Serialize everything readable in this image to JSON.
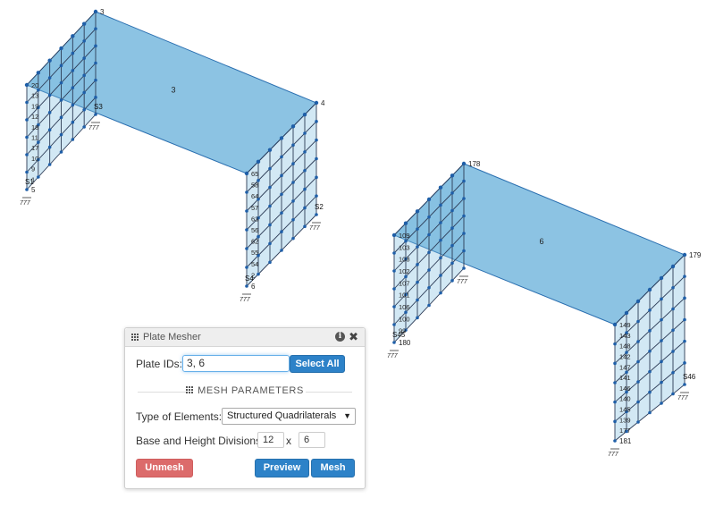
{
  "viewport": {
    "plate_colors": {
      "fill": "#7fbde0",
      "edge": "#2a6fb0",
      "mesh": "#2b3a55",
      "node": "#1f5fa8"
    },
    "left_frame": {
      "plate_label": "3",
      "corner_labels": [
        "3",
        "4",
        "5",
        "6"
      ],
      "node_labels_a": [
        "20",
        "13",
        "19",
        "12",
        "18",
        "11",
        "17",
        "10",
        "9",
        "1"
      ],
      "node_labels_b": [
        "65",
        "58",
        "64",
        "57",
        "63",
        "56",
        "62",
        "55",
        "54",
        "2"
      ],
      "member_labels": [
        "S1",
        "S2",
        "S3",
        "S4"
      ],
      "support_symbol": "777"
    },
    "right_frame": {
      "plate_label": "6",
      "corner_labels": [
        "178",
        "179",
        "180",
        "181"
      ],
      "node_labels_a": [
        "109",
        "103",
        "108",
        "102",
        "107",
        "101",
        "106",
        "100",
        "99"
      ],
      "node_labels_b": [
        "149",
        "143",
        "148",
        "142",
        "147",
        "141",
        "146",
        "140",
        "145",
        "139",
        "177"
      ],
      "member_labels": [
        "S45",
        "S46"
      ],
      "support_symbol": "777"
    }
  },
  "panel": {
    "title": "Plate Mesher",
    "info_icon": "info-icon",
    "close_symbol": "✖",
    "plate_ids_label": "Plate IDs:",
    "plate_ids_value": "3, 6",
    "select_all_label": "Select All",
    "section_title": "MESH PARAMETERS",
    "type_label": "Type of Elements:",
    "type_value": "Structured Quadrilaterals",
    "divisions_label": "Base and Height Divisions:",
    "base_divisions": "12",
    "times_symbol": "x",
    "height_divisions": "6",
    "unmesh_label": "Unmesh",
    "preview_label": "Preview",
    "mesh_label": "Mesh"
  }
}
